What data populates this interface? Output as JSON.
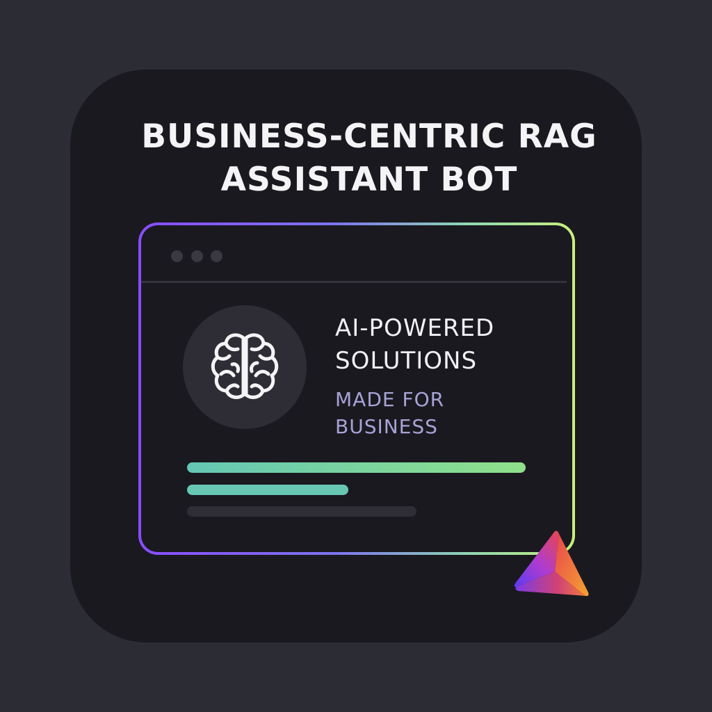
{
  "title": {
    "line1": "BUSINESS-CENTRIC RAG",
    "line2": "ASSISTANT BOT"
  },
  "window": {
    "headline": {
      "line1": "AI-POWERED",
      "line2": "SOLUTIONS"
    },
    "subline": {
      "line1": "MADE FOR",
      "line2": "BUSINESS"
    }
  },
  "icons": {
    "feature": "brain-icon",
    "brand": "triangle-logo-icon"
  },
  "colors": {
    "background": "#2c2c34",
    "card": "#1a1920",
    "accent_purple": "#8a4cff",
    "accent_green": "#c8f07a",
    "teal": "#64c7b5",
    "subtext": "#a8a3d6"
  }
}
